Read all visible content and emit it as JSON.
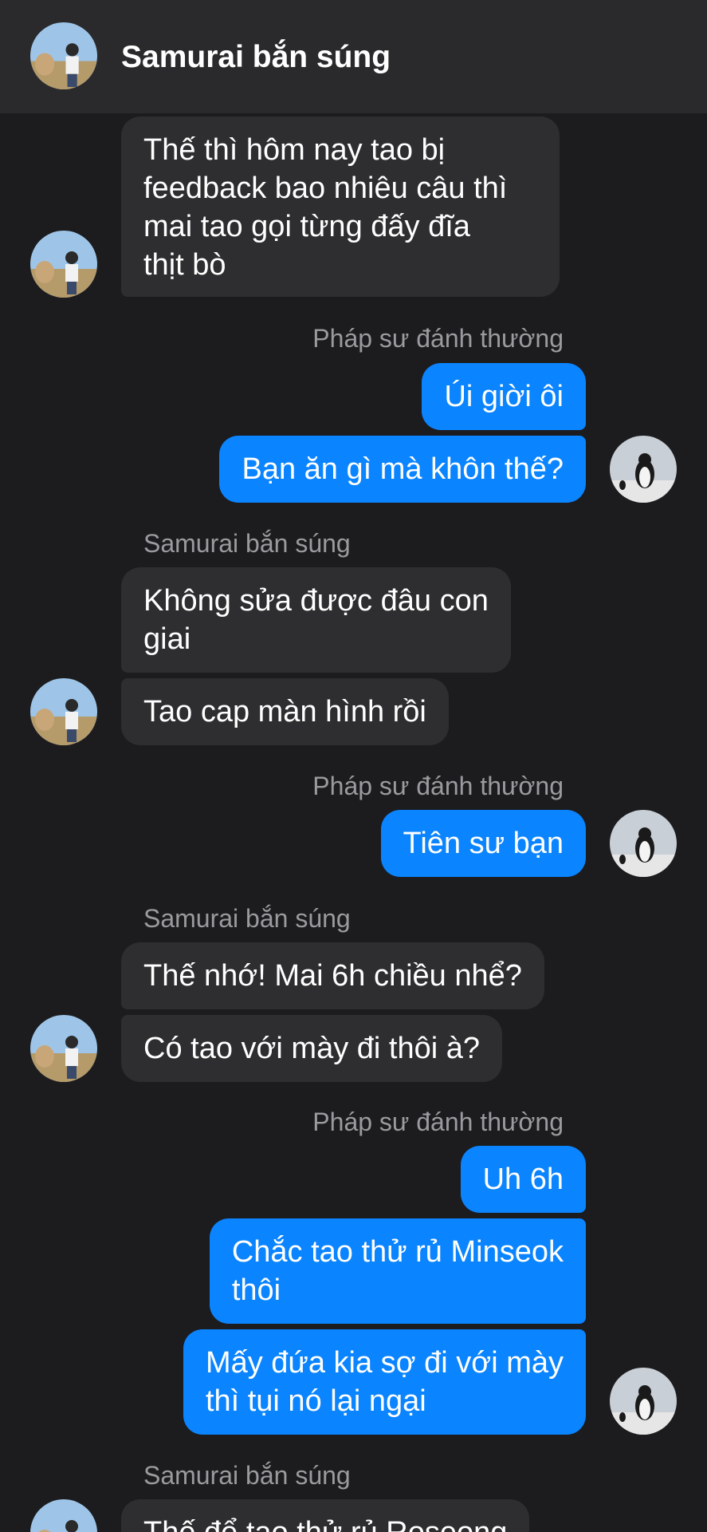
{
  "header": {
    "title": "Samurai bắn súng",
    "avatar_icon": "contact-avatar-icon"
  },
  "senders": {
    "them": "Samurai bắn súng",
    "me": "Pháp sư đánh thường"
  },
  "messages": [
    {
      "from": "them",
      "text_lines": [
        "Thế thì hôm nay tao bị",
        "feedback bao nhiêu câu thì",
        "mai tao gọi từng đấy đĩa",
        "thịt bò"
      ]
    },
    {
      "from": "me",
      "text_lines": [
        "Úi giời ôi"
      ]
    },
    {
      "from": "me",
      "text_lines": [
        "Bạn ăn gì mà khôn thế?"
      ]
    },
    {
      "from": "them",
      "text_lines": [
        "Không sửa được đâu con",
        "giai"
      ]
    },
    {
      "from": "them",
      "text_lines": [
        "Tao cap màn hình rồi"
      ]
    },
    {
      "from": "me",
      "text_lines": [
        "Tiên sư bạn"
      ]
    },
    {
      "from": "them",
      "text_lines": [
        "Thế nhớ! Mai 6h chiều nhể?"
      ]
    },
    {
      "from": "them",
      "text_lines": [
        "Có tao với mày đi thôi à?"
      ]
    },
    {
      "from": "me",
      "text_lines": [
        "Uh 6h"
      ]
    },
    {
      "from": "me",
      "text_lines": [
        "Chắc tao thử rủ Minseok",
        "thôi"
      ]
    },
    {
      "from": "me",
      "text_lines": [
        "Mấy đứa kia sợ đi với mày",
        "thì tụi nó lại ngại"
      ]
    },
    {
      "from": "them",
      "text_lines": [
        "Thế để tao thử rủ Roseong"
      ]
    }
  ],
  "colors": {
    "background": "#1c1c1e",
    "header": "#2a2a2c",
    "incoming_bubble": "#2e2e30",
    "outgoing_bubble": "#0a84ff",
    "sender_label": "#9b9b9f"
  }
}
